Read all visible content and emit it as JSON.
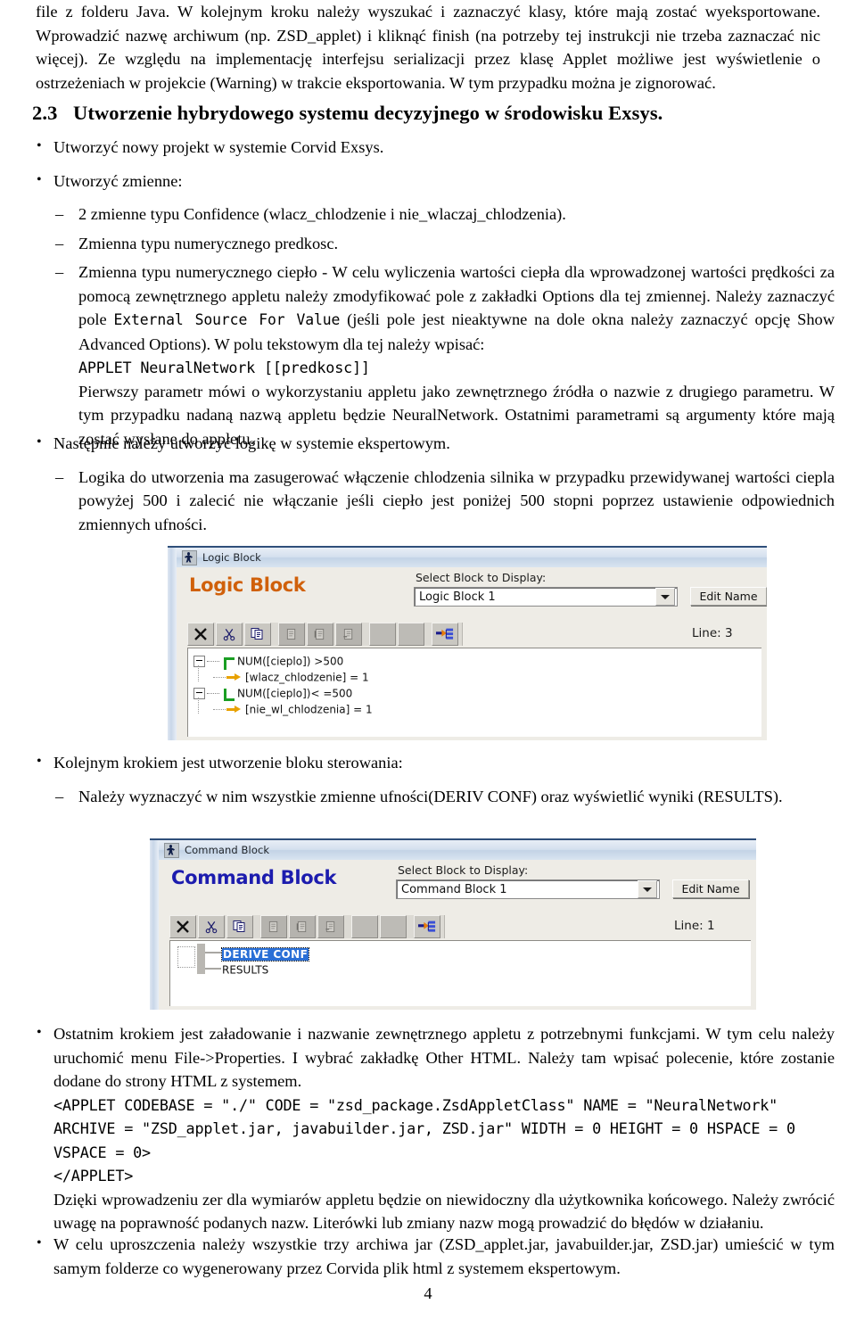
{
  "page": {
    "number": "4"
  },
  "top_paragraph": {
    "text": "file z folderu Java. W kolejnym kroku należy wyszukać i zaznaczyć klasy, które mają zostać wyeksportowane. Wprowadzić nazwę archiwum (np. ZSD_applet) i kliknąć finish (na potrzeby tej instrukcji nie trzeba zaznaczać nic więcej). Ze względu na implementację interfejsu serializacji przez klasę Applet możliwe jest wyświetlenie o ostrzeżeniach w projekcie (Warning) w trakcie eksportowania. W tym przypadku można je zignorować."
  },
  "section": {
    "number": "2.3",
    "title": "Utworzenie hybrydowego systemu decyzyjnego w środowisku Exsys."
  },
  "bullets_a": {
    "item1": "Utworzyć nowy projekt w systemie Corvid Exsys.",
    "item2": "Utworzyć zmienne:",
    "sub1": "2 zmienne typu Confidence (wlacz_chlodzenie i nie_wlaczaj_chlodzenia).",
    "sub2": "Zmienna typu numerycznego predkosc.",
    "sub3_part1": "Zmienna typu numerycznego ciepło - W celu wyliczenia wartości ciepła dla wprowadzonej wartości prędkości za pomocą zewnętrznego appletu należy zmodyfikować pole z zakładki Options dla tej zmiennej. Należy zaznaczyć pole ",
    "sub3_code1": "External Source For Value",
    "sub3_part2": " (jeśli pole jest nieaktywne na dole okna należy zaznaczyć opcję Show Advanced Options). W polu tekstowym dla tej należy wpisać:",
    "sub3_code2": "APPLET NeuralNetwork [[predkosc]]",
    "sub3_part3": "Pierwszy parametr mówi o wykorzystaniu appletu jako zewnętrznego źródła o nazwie z drugiego parametru. W tym przypadku nadaną nazwą appletu będzie NeuralNetwork. Ostatnimi parametrami są argumenty które mają zostać wysłane do appletu."
  },
  "bullets_b": {
    "item1": "Następnie należy utworzyć logikę w systemie ekspertowym.",
    "sub1": "Logika do utworzenia ma zasugerować włączenie chlodzenia silnika w przypadku przewidywanej wartości ciepla powyżej 500 i zalecić nie włączanie jeśli ciepło jest poniżej 500 stopni poprzez ustawienie odpowiednich zmiennych ufności."
  },
  "bullets_c": {
    "item1": "Kolejnym krokiem jest utworzenie bloku sterowania:",
    "sub1": "Należy wyznaczyć w nim wszystkie zmienne ufności(DERIV CONF) oraz wyświetlić wyniki (RESULTS)."
  },
  "bullets_d": {
    "item1_part1": "Ostatnim krokiem jest załadowanie i nazwanie zewnętrznego appletu z potrzebnymi funkcjami. W tym celu należy uruchomić menu File->Properties. I wybrać zakładkę Other HTML. Należy tam wpisać polecenie, które zostanie dodane do strony HTML z systemem.",
    "code_line1": "<APPLET CODEBASE = \"./\" CODE = \"zsd_package.ZsdAppletClass\" NAME = \"NeuralNetwork\"",
    "code_line2": "ARCHIVE = \"ZSD_applet.jar, javabuilder.jar, ZSD.jar\" WIDTH = 0 HEIGHT = 0 HSPACE = 0",
    "code_line3": "VSPACE = 0>",
    "code_line4": "</APPLET>",
    "item1_part2": "Dzięki wprowadzeniu zer dla wymiarów appletu będzie on niewidoczny dla użytkownika końcowego. Należy zwrócić uwagę na poprawność podanych nazw. Literówki lub zmiany nazw mogą prowadzić do błędów w działaniu."
  },
  "bullets_e": {
    "item1": "W celu uproszczenia należy wszystkie trzy archiwa jar (ZSD_applet.jar, javabuilder.jar, ZSD.jar) umieścić w tym samym folderze co wygenerowany przez Corvida plik html z systemem ekspertowym."
  },
  "logic_block_window": {
    "titlebar": "Logic Block",
    "heading": "Logic Block",
    "heading_color": "#d0600a",
    "select_label": "Select Block to Display:",
    "combo_value": "Logic Block 1",
    "edit_name_button": "Edit Name",
    "line_info": "Line: 3",
    "tree": [
      {
        "text": "NUM([cieplo]) >500",
        "kind": "condition-top"
      },
      {
        "text": "[wlacz_chlodzenie] = 1",
        "kind": "action"
      },
      {
        "text": "NUM([cieplo])< =500",
        "kind": "condition-bottom"
      },
      {
        "text": "[nie_wl_chlodzenia] = 1",
        "kind": "action"
      }
    ]
  },
  "command_block_window": {
    "titlebar": "Command Block",
    "heading": "Command Block",
    "heading_color": "#1c1cae",
    "select_label": "Select Block to Display:",
    "combo_value": "Command Block 1",
    "edit_name_button": "Edit Name",
    "line_info": "Line: 1",
    "tree": [
      {
        "text": "DERIVE CONF",
        "selected": true
      },
      {
        "text": "RESULTS",
        "selected": false
      }
    ]
  }
}
